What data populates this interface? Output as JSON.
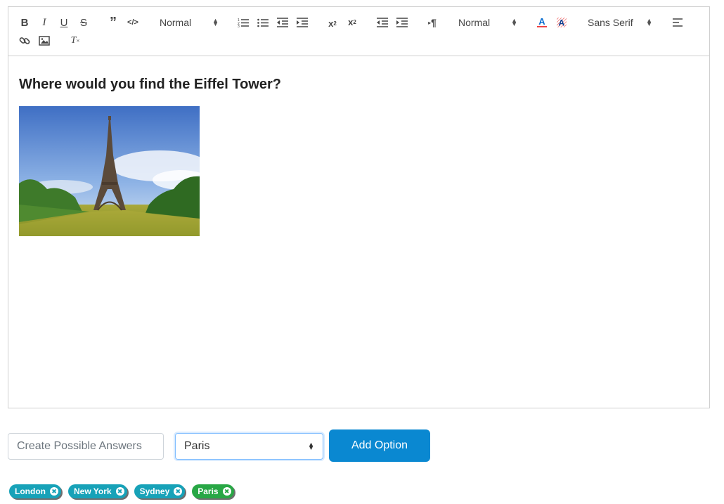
{
  "toolbar": {
    "header_select": "Normal",
    "size_select": "Normal",
    "font_select": "Sans Serif",
    "icons": [
      "bold-icon",
      "italic-icon",
      "underline-icon",
      "strike-icon",
      "blockquote-icon",
      "code-icon",
      "ordered-list-icon",
      "bullet-list-icon",
      "indent-decrease-icon",
      "indent-increase-icon",
      "subscript-icon",
      "superscript-icon",
      "outdent-icon",
      "indent-icon",
      "rtl-direction-icon",
      "text-color-icon",
      "background-color-icon",
      "align-icon",
      "link-icon",
      "image-icon",
      "clear-format-icon"
    ]
  },
  "content": {
    "question": "Where would you find the Eiffel Tower?"
  },
  "controls": {
    "answer_placeholder": "Create Possible Answers",
    "selected_answer": "Paris",
    "add_button": "Add Option"
  },
  "tags": [
    {
      "label": "London",
      "color": "#17a2b8"
    },
    {
      "label": "New York",
      "color": "#17a2b8"
    },
    {
      "label": "Sydney",
      "color": "#17a2b8"
    },
    {
      "label": "Paris",
      "color": "#28a745"
    }
  ]
}
